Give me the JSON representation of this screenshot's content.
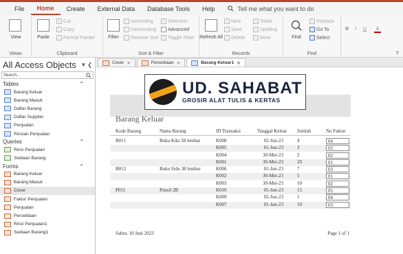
{
  "menu": {
    "tabs": [
      "File",
      "Home",
      "Create",
      "External Data",
      "Database Tools",
      "Help"
    ],
    "active": "Home",
    "tell_me": "Tell me what you want to do"
  },
  "ribbon": {
    "views": {
      "view_label": "View",
      "group": "Views"
    },
    "clipboard": {
      "paste": "Paste",
      "cut": "Cut",
      "copy": "Copy",
      "format_painter": "Format Painter",
      "group": "Clipboard"
    },
    "sort_filter": {
      "filter": "Filter",
      "ascending": "Ascending",
      "descending": "Descending",
      "remove_sort": "Remove Sort",
      "selection": "Selection",
      "advanced": "Advanced",
      "toggle_filter": "Toggle Filter",
      "group": "Sort & Filter"
    },
    "records": {
      "refresh_all": "Refresh All",
      "new": "New",
      "save": "Save",
      "delete": "Delete",
      "totals": "Totals",
      "spelling": "Spelling",
      "more": "More",
      "group": "Records"
    },
    "find": {
      "find": "Find",
      "replace": "Replace",
      "goto": "Go To",
      "select": "Select",
      "group": "Find"
    },
    "text_formatting": {
      "bold": "B",
      "italic": "I",
      "underline": "U",
      "group": "T"
    }
  },
  "nav": {
    "title": "All Access Objects",
    "search_placeholder": "Search...",
    "sections": [
      {
        "name": "Tables",
        "items": [
          "Barang Keluar",
          "Barang Masuk",
          "Daftar Barang",
          "Daftar Supplier",
          "Penjualan",
          "Rincian Penjualan"
        ]
      },
      {
        "name": "Queries",
        "items": [
          "Rinci Penjualan",
          "Sediaan Barang"
        ]
      },
      {
        "name": "Forms",
        "items": [
          "Barang Keluar",
          "Barang Masuk",
          "Cover",
          "Faktur Penjualan",
          "Penjualan",
          "Persediaan",
          "Rinci Penjualan1",
          "Sediaan Barang1"
        ]
      }
    ],
    "selected": "Cover"
  },
  "doc_tabs": [
    {
      "label": "Cover",
      "active": false
    },
    {
      "label": "Persediaan",
      "active": false
    },
    {
      "label": "Barang Keluar1",
      "active": true
    }
  ],
  "report": {
    "logo_brand": "UD. SAHABAT",
    "logo_tagline": "GROSIR ALAT TULIS & KERTAS",
    "title": "Barang Keluar",
    "columns": [
      "Kode Barang",
      "Nama Barang",
      "ID Transaksi",
      "Tanggal Keluar",
      "Jumlah",
      "No Faktur"
    ],
    "rows": [
      {
        "kode": "B011",
        "nama": "Buku Kiki 38 lembar",
        "id": "K008",
        "tgl": "02-Jun-23",
        "jml": "4",
        "faktur": "04"
      },
      {
        "kode": "",
        "nama": "",
        "id": "K005",
        "tgl": "01-Jun-23",
        "jml": "3",
        "faktur": "03"
      },
      {
        "kode": "",
        "nama": "",
        "id": "K004",
        "tgl": "30-Mei-23",
        "jml": "2",
        "faktur": "02"
      },
      {
        "kode": "",
        "nama": "",
        "id": "K001",
        "tgl": "30-Mei-23",
        "jml": "20",
        "faktur": "01"
      },
      {
        "kode": "B012",
        "nama": "Buku Sidu 38 lembar",
        "id": "K006",
        "tgl": "01-Jun-23",
        "jml": "7",
        "faktur": "03"
      },
      {
        "kode": "",
        "nama": "",
        "id": "K002",
        "tgl": "30-Mei-23",
        "jml": "5",
        "faktur": "01"
      },
      {
        "kode": "",
        "nama": "",
        "id": "K003",
        "tgl": "30-Mei-23",
        "jml": "10",
        "faktur": "02"
      },
      {
        "kode": "P011",
        "nama": "Pensil 2B",
        "id": "K010",
        "tgl": "05-Jun-23",
        "jml": "15",
        "faktur": "05"
      },
      {
        "kode": "",
        "nama": "",
        "id": "K009",
        "tgl": "02-Jun-23",
        "jml": "1",
        "faktur": "04"
      },
      {
        "kode": "",
        "nama": "",
        "id": "K007",
        "tgl": "01-Jun-23",
        "jml": "10",
        "faktur": "03"
      }
    ],
    "footer_date": "Sabtu, 10 Juni 2023",
    "footer_page": "Page 1 of 1"
  }
}
